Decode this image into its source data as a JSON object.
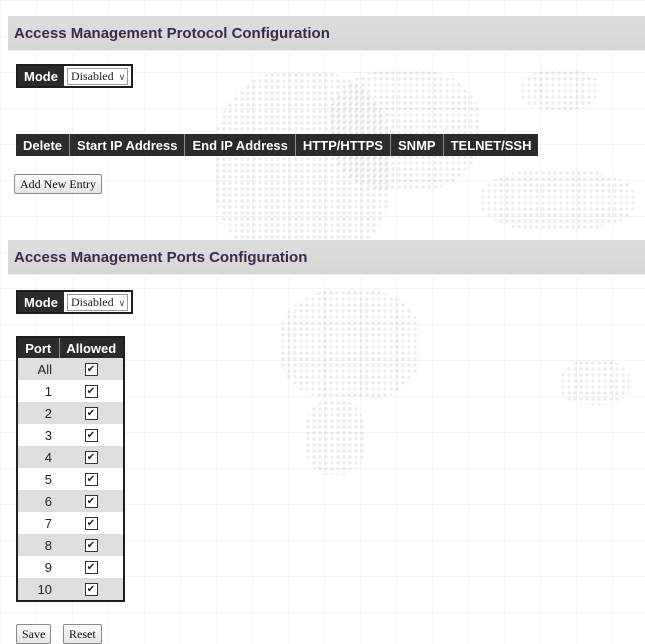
{
  "protocol_section": {
    "title": "Access Management Protocol Configuration",
    "mode_label": "Mode",
    "mode_value": "Disabled",
    "columns": [
      "Delete",
      "Start IP Address",
      "End IP Address",
      "HTTP/HTTPS",
      "SNMP",
      "TELNET/SSH"
    ],
    "add_button": "Add New Entry"
  },
  "ports_section": {
    "title": "Access Management Ports Configuration",
    "mode_label": "Mode",
    "mode_value": "Disabled",
    "columns": [
      "Port",
      "Allowed"
    ],
    "rows": [
      {
        "port": "All",
        "allowed": true
      },
      {
        "port": "1",
        "allowed": true
      },
      {
        "port": "2",
        "allowed": true
      },
      {
        "port": "3",
        "allowed": true
      },
      {
        "port": "4",
        "allowed": true
      },
      {
        "port": "5",
        "allowed": true
      },
      {
        "port": "6",
        "allowed": true
      },
      {
        "port": "7",
        "allowed": true
      },
      {
        "port": "8",
        "allowed": true
      },
      {
        "port": "9",
        "allowed": true
      },
      {
        "port": "10",
        "allowed": true
      }
    ]
  },
  "buttons": {
    "save": "Save",
    "reset": "Reset"
  },
  "icons": {
    "dropdown": "chevron-down-icon",
    "checkbox": "checkmark-icon"
  },
  "colors": {
    "header_bg": "#2b2b2b",
    "title_color": "#3a2b4a",
    "title_bar": "#d9d9d9"
  }
}
